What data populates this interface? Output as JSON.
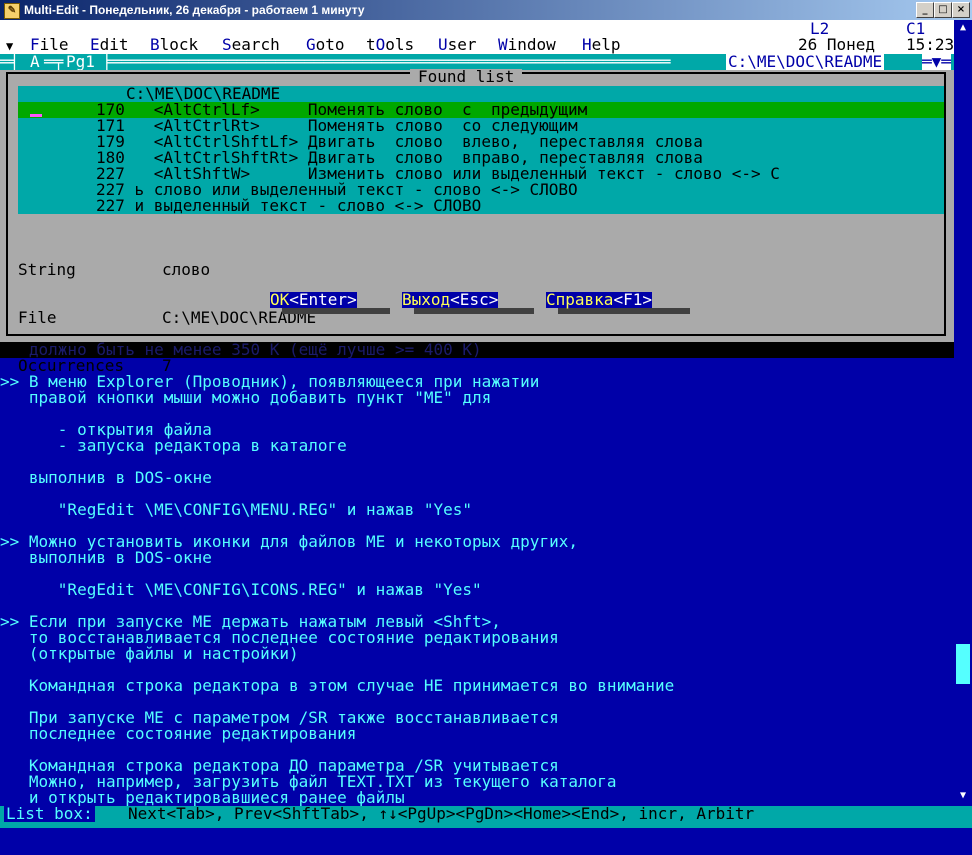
{
  "window": {
    "title": "Multi-Edit - Понедельник, 26 декабря - работаем 1 минуту",
    "controls": [
      "_",
      "□",
      "×"
    ]
  },
  "menubar": {
    "items": [
      "File",
      "Edit",
      "Block",
      "Search",
      "Goto",
      "tOols",
      "User",
      "Window",
      "Help"
    ],
    "line_label": "L2",
    "col_label": "C1",
    "date": "26 Понед",
    "time": "15:23"
  },
  "statusline": {
    "window_letter": "A",
    "page": "Pg1",
    "file": "C:\\ME\\DOC\\README"
  },
  "dialog": {
    "title": "Found list",
    "list_header": "C:\\ME\\DOC\\README",
    "rows": [
      "170   <AltCtrlLf>     Поменять слово  с  предыдущим",
      "171   <AltCtrlRt>     Поменять слово  со следующим",
      "179   <AltCtrlShftLf> Двигать  слово  влево,  переставляя слова",
      "180   <AltCtrlShftRt> Двигать  слово  вправо, переставляя слова",
      "227   <AltShftW>      Изменить слово или выделенный текст - слово <-> С",
      "227 ь слово или выделенный текст - слово <-> СЛОВО",
      "227 и выделенный текст - слово <-> СЛОВО"
    ],
    "selected_index": 0,
    "info_labels": [
      "String",
      "File",
      "Occurrences"
    ],
    "info_values": [
      "слово",
      "C:\\ME\\DOC\\README",
      "7"
    ],
    "buttons": [
      {
        "hot": "OK",
        "rest": "<Enter>"
      },
      {
        "hot": "Выход",
        "rest": "<Esc>"
      },
      {
        "hot": "Справка",
        "rest": "<F1>"
      }
    ]
  },
  "editor": {
    "partial_line": "   должно быть не менее 350 К (ещё лучше >= 400 К)",
    "lines": [
      "",
      ">> В меню Explorer (Проводник), появляющееся при нажатии",
      "   правой кнопки мыши можно добавить пункт \"МЕ\" для",
      "",
      "      - открытия файла",
      "      - запуска редактора в каталоге",
      "",
      "   выполнив в DOS-окне",
      "",
      "      \"RegEdit \\ME\\CONFIG\\MENU.REG\" и нажав \"Yes\"",
      "",
      ">> Можно установить иконки для файлов МЕ и некоторых других,",
      "   выполнив в DOS-окне",
      "",
      "      \"RegEdit \\ME\\CONFIG\\ICONS.REG\" и нажав \"Yes\"",
      "",
      ">> Если при запуске МЕ держать нажатым левый <Shft>,",
      "   то восстанавливается последнее состояние редактирования",
      "   (открытые файлы и настройки)",
      "",
      "   Командная строка редактора в этом случае НЕ принимается во внимание",
      "",
      "   При запуске МЕ с параметром /SR также восстанавливается",
      "   последнее состояние редактирования",
      "",
      "   Командная строка редактора ДО параметра /SR учитывается",
      "   Можно, например, загрузить файл TEXT.TXT из текущего каталога",
      "   и открыть редактировавшиеся ранее файлы"
    ]
  },
  "bottombar": {
    "label": "List box:",
    "hint": "Next<Tab>, Prev<ShftTab>, ↑↓<PgUp><PgDn><Home><End>, incr, Arbitr"
  }
}
